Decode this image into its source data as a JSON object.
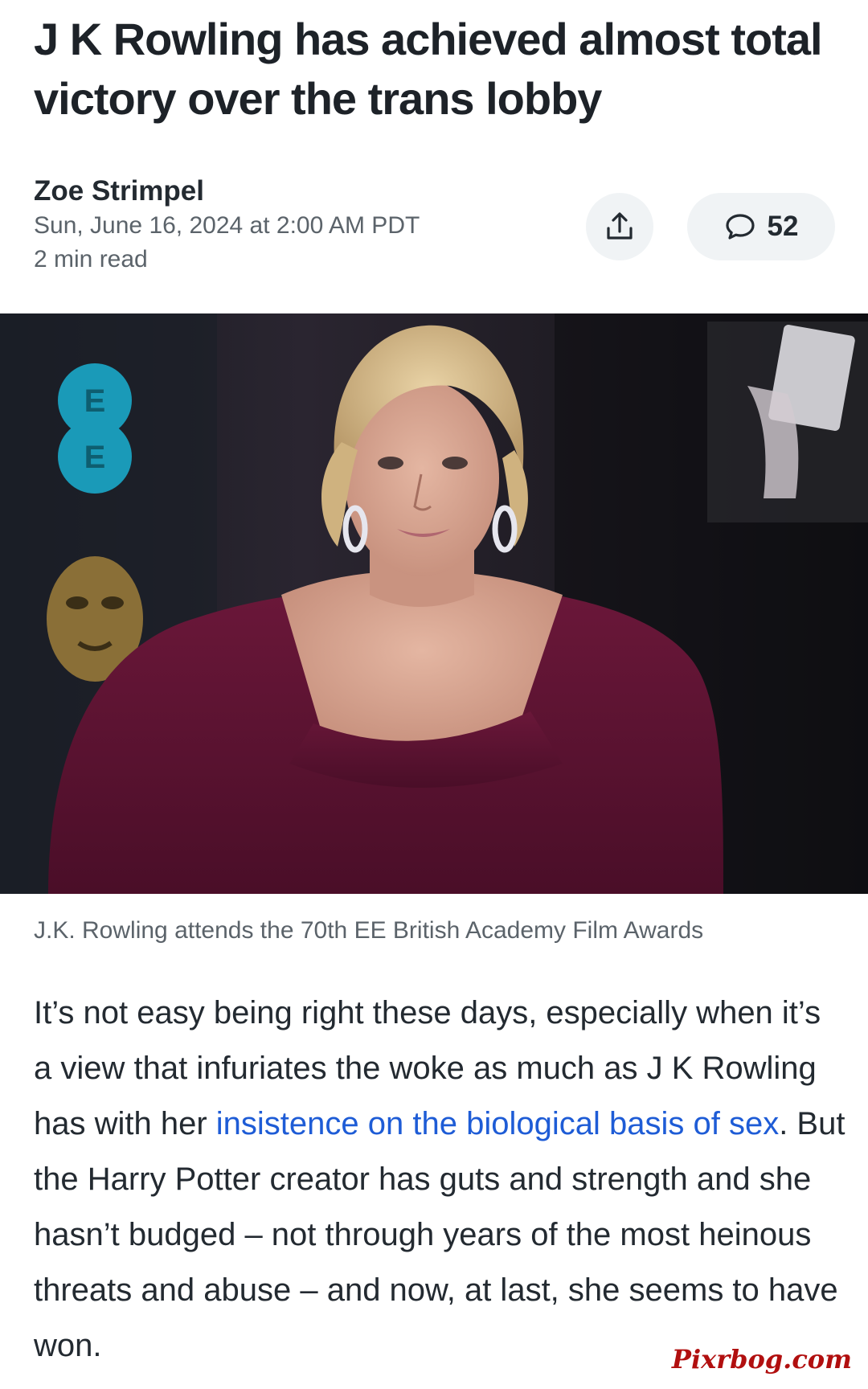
{
  "article": {
    "headline": "J K Rowling has achieved almost total victory over the trans lobby",
    "author": "Zoe Strimpel",
    "date": "Sun, June 16, 2024 at 2:00 AM PDT",
    "read_time": "2 min read"
  },
  "actions": {
    "share_icon": "share-icon",
    "comment_icon": "comment-icon",
    "comment_count": "52"
  },
  "image": {
    "caption": "J.K. Rowling attends the 70th EE British Academy Film Awards",
    "sign_letters": [
      "E",
      "E"
    ]
  },
  "body": {
    "text_before_link": "It’s not easy being right these days, especially when it’s a view that infuriates the woke as much as J K Rowling has with her ",
    "link_text": "insistence on the biological basis of sex",
    "text_after_link": ". But the Harry Potter creator has guts and strength and she hasn’t budged – not through years of the most heinous threats and abuse – and now, at last, she seems to have won."
  },
  "watermark": "Pixrbog.com",
  "colors": {
    "link": "#1e5cd6",
    "dress": "#5e1334",
    "ee_logo": "#1a9ab8"
  }
}
